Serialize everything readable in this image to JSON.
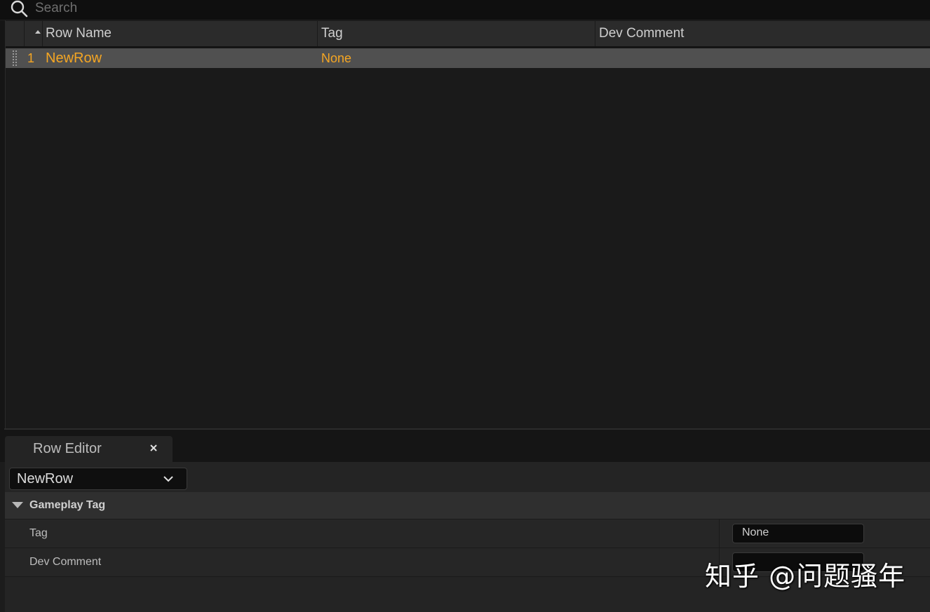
{
  "search": {
    "placeholder": "Search",
    "value": ""
  },
  "table": {
    "columns": [
      "Row Name",
      "Tag",
      "Dev Comment"
    ],
    "rows": [
      {
        "index": "1",
        "row_name": "NewRow",
        "tag": "None",
        "dev_comment": ""
      }
    ],
    "highlight_color": "#f5a623"
  },
  "row_editor": {
    "tab_label": "Row Editor",
    "selected_row": "NewRow",
    "category": "Gameplay Tag",
    "properties": [
      {
        "label": "Tag",
        "value": "None"
      },
      {
        "label": "Dev Comment",
        "value": ""
      }
    ]
  },
  "watermark": "知乎 @问题骚年"
}
